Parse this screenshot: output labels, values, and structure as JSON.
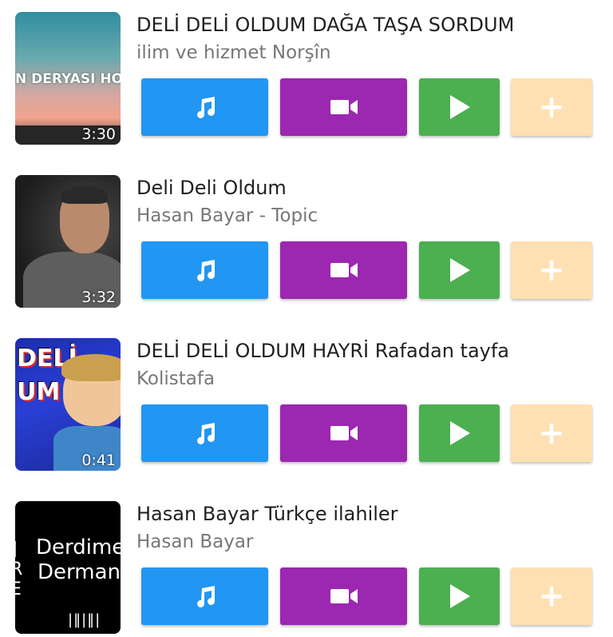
{
  "items": [
    {
      "title": "DELİ DELİ OLDUM DAĞA TAŞA SORDUM",
      "channel": "ilim ve hizmet Norşîn",
      "duration": "3:30",
      "thumb_text": "N DERYASI HOS"
    },
    {
      "title": "Deli Deli Oldum",
      "channel": "Hasan Bayar - Topic",
      "duration": "3:32"
    },
    {
      "title": "DELİ DELİ OLDUM HAYRİ Rafadan tayfa",
      "channel": "Kolistafa",
      "duration": "0:41",
      "thumb_text_1": "DELİ",
      "thumb_text_2": "UM"
    },
    {
      "title": "Hasan Bayar Türkçe ilahiler",
      "channel": "Hasan Bayar",
      "thumb_text_1": "Derdime",
      "thumb_text_2": "Derman"
    }
  ],
  "buttons": {
    "audio_icon": "music-note-icon",
    "video_icon": "video-camera-icon",
    "play_icon": "play-icon",
    "add_label": "+"
  },
  "colors": {
    "audio": "#2196f3",
    "video": "#9c27b0",
    "play": "#4caf50",
    "add": "#ffe0b2"
  }
}
